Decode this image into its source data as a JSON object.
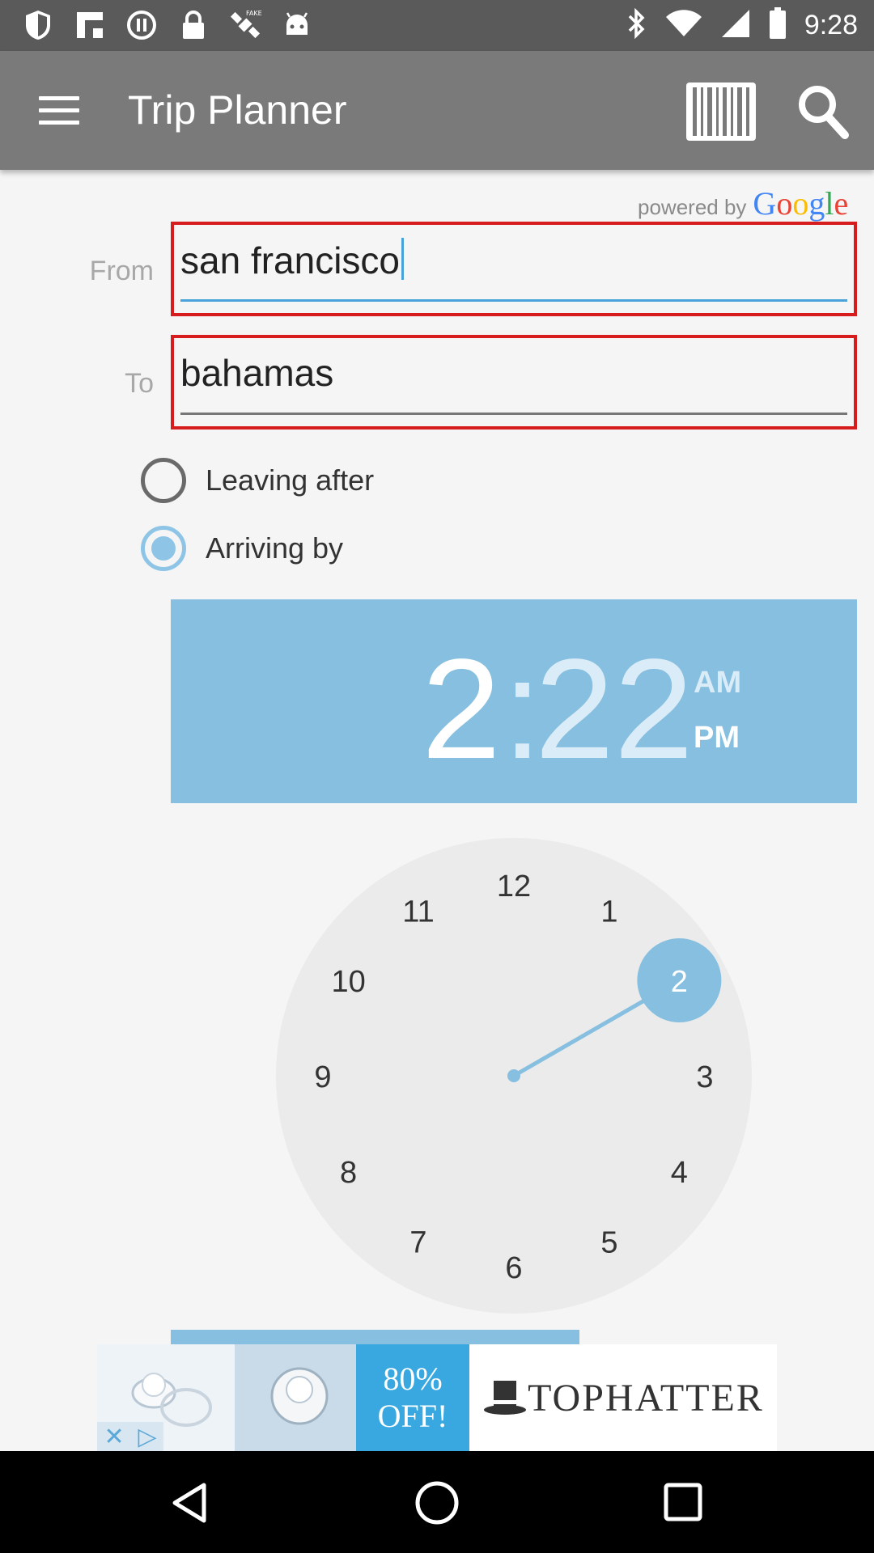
{
  "status_bar": {
    "time": "9:28",
    "left_icons": [
      "shield-icon",
      "flipboard-icon",
      "record-icon",
      "lock-icon",
      "satellite-fake-gps-icon",
      "android-icon"
    ],
    "right_icons": [
      "bluetooth-icon",
      "wifi-icon",
      "signal-icon",
      "battery-icon"
    ]
  },
  "app_bar": {
    "title": "Trip Planner"
  },
  "powered_by": {
    "text": "powered by",
    "brand": "Google"
  },
  "form": {
    "from_label": "From",
    "from_value": "san francisco",
    "to_label": "To",
    "to_value": "bahamas"
  },
  "options": {
    "leaving_after": "Leaving after",
    "arriving_by": "Arriving by",
    "selected": "arriving_by"
  },
  "time_picker": {
    "hour": "2",
    "colon": ":",
    "minute": "22",
    "am": "AM",
    "pm": "PM",
    "selected_period": "PM",
    "dial_numbers": [
      "12",
      "1",
      "2",
      "3",
      "4",
      "5",
      "6",
      "7",
      "8",
      "9",
      "10",
      "11"
    ],
    "selected_hour": "2"
  },
  "ad": {
    "brand": "TOPHATTER",
    "promo": "80% OFF!"
  },
  "colors": {
    "accent": "#86bfdf",
    "error_border": "#d61c1c",
    "app_bar": "#7a7a7a",
    "status_bar": "#5a5a5a"
  }
}
